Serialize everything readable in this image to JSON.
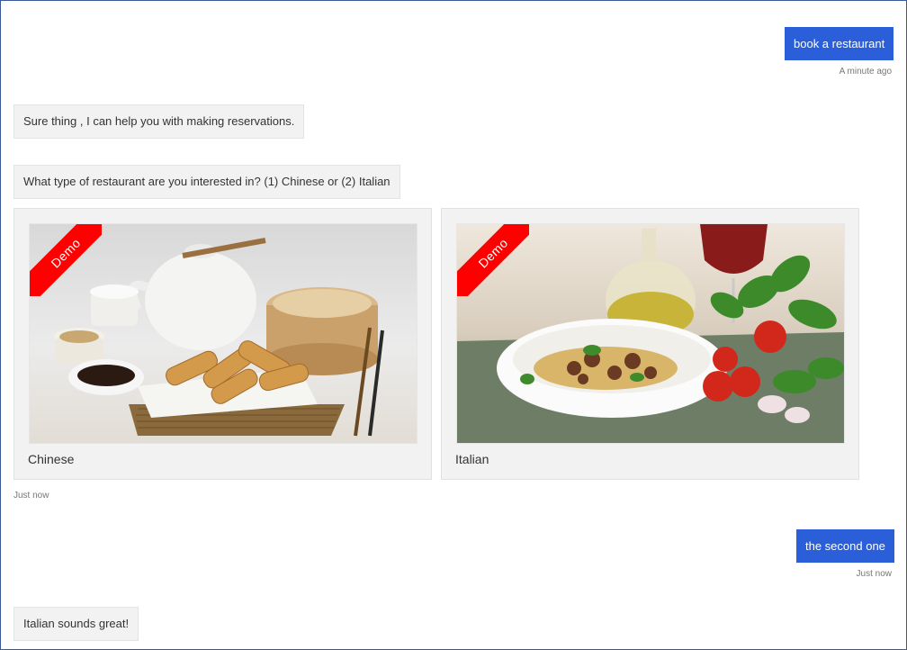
{
  "messages": {
    "user1": {
      "text": "book a restaurant",
      "time": "A minute ago"
    },
    "bot1": {
      "text": "Sure thing , I can help you with making reservations."
    },
    "bot2": {
      "text": "What type of restaurant are you interested in? (1) Chinese or (2) Italian"
    },
    "cards_time": "Just now",
    "user2": {
      "text": "the second one",
      "time": "Just now"
    },
    "bot3": {
      "text": "Italian sounds great!"
    }
  },
  "cards": [
    {
      "title": "Chinese",
      "ribbon": "Demo",
      "image": "chinese-food-photo"
    },
    {
      "title": "Italian",
      "ribbon": "Demo",
      "image": "italian-food-photo"
    }
  ],
  "colors": {
    "user_bubble": "#2b5fd9",
    "bot_bubble": "#f2f2f2",
    "ribbon": "#ff0000"
  }
}
